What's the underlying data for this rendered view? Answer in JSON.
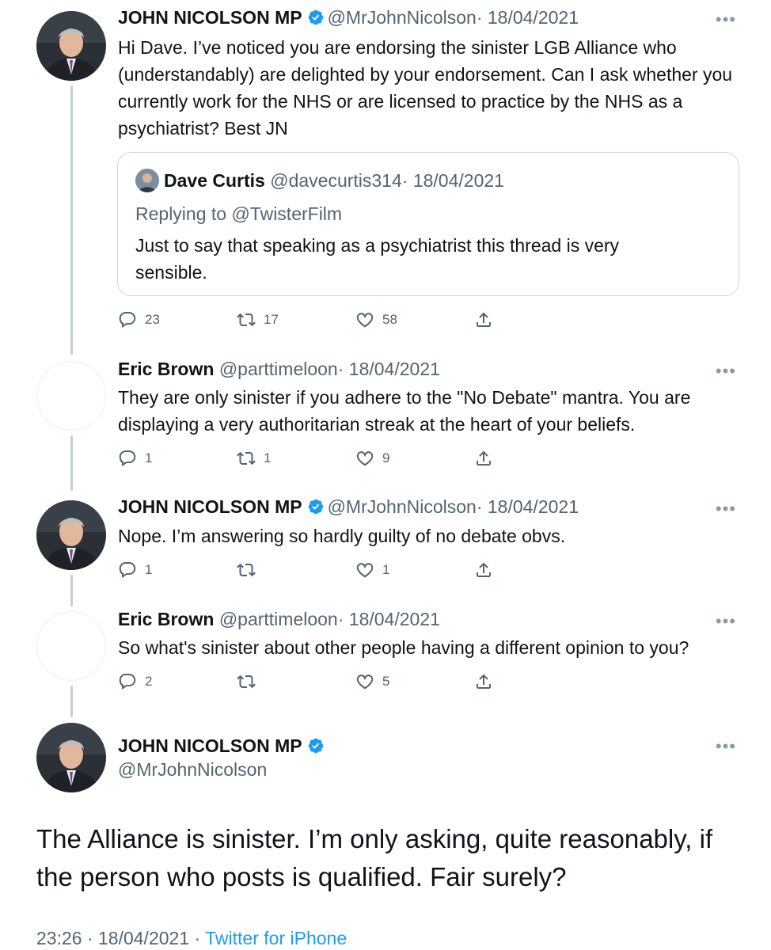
{
  "tweets": [
    {
      "name": "JOHN NICOLSON MP",
      "handle": "@MrJohnNicolson",
      "date": "· 18/04/2021",
      "text": "Hi Dave. I’ve noticed you are endorsing the sinister LGB Alliance who (understandably) are delighted by your endorsement. Can I ask whether you currently work for the NHS or are licensed to practice by the NHS as a psychiatrist? Best JN",
      "replies": "23",
      "retweets": "17",
      "likes": "58",
      "quote": {
        "name": "Dave Curtis",
        "handle": "@davecurtis314",
        "date": "· 18/04/2021",
        "replying": "Replying to @TwisterFilm",
        "text": "Just to say that speaking as a psychiatrist this thread is very sensible."
      }
    },
    {
      "name": "Eric Brown",
      "handle": "@parttimeloon",
      "date": "· 18/04/2021",
      "text": "They are only sinister if you adhere to the \"No Debate\" mantra. You are displaying a very authoritarian streak at the heart of your beliefs.",
      "replies": "1",
      "retweets": "1",
      "likes": "9"
    },
    {
      "name": "JOHN NICOLSON MP",
      "handle": "@MrJohnNicolson",
      "date": "· 18/04/2021",
      "text": "Nope. I’m answering so hardly guilty of no debate obvs.",
      "replies": "1",
      "retweets": "",
      "likes": "1"
    },
    {
      "name": "Eric Brown",
      "handle": "@parttimeloon",
      "date": "· 18/04/2021",
      "text": "So what's sinister about other people having a different opinion to you?",
      "replies": "2",
      "retweets": "",
      "likes": "5"
    }
  ],
  "main": {
    "name": "JOHN NICOLSON MP",
    "handle": "@MrJohnNicolson",
    "text": "The Alliance is sinister. I’m only asking, quite reasonably, if the person who posts is qualified. Fair surely?",
    "time": "23:26 · 18/04/2021 ·",
    "source": "Twitter for iPhone"
  },
  "more_label": "•••",
  "colors": {
    "verified": "#1d9bf0",
    "link": "#1d9bf0",
    "secondary": "#536471"
  }
}
